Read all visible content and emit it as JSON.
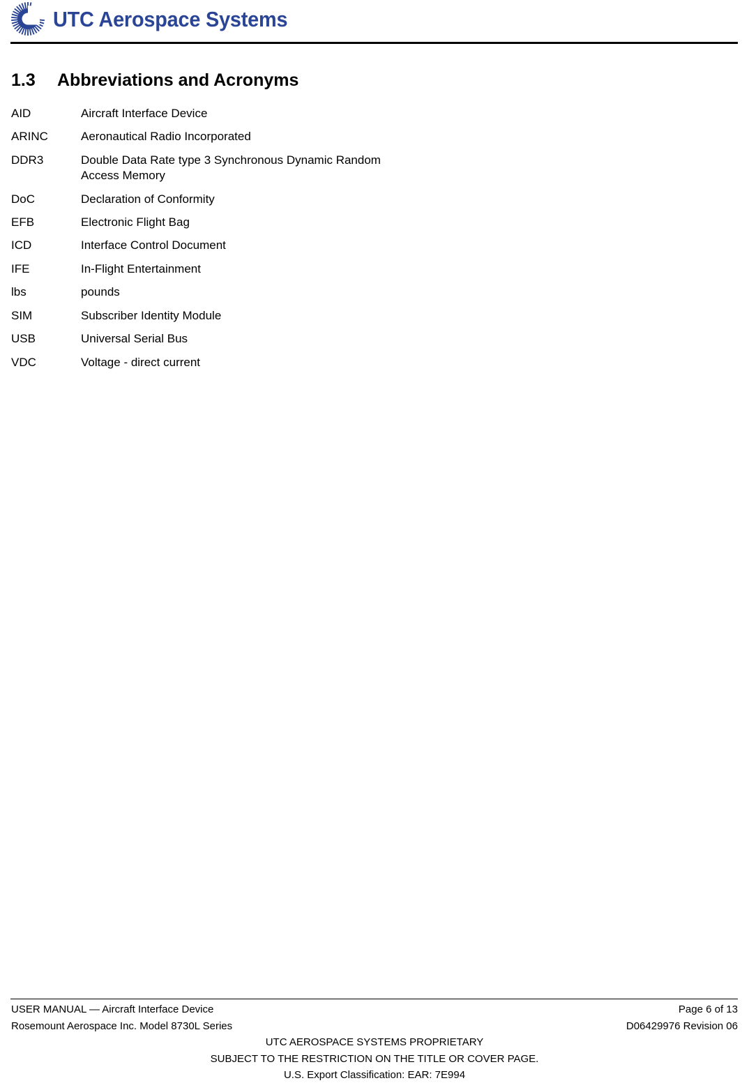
{
  "header": {
    "logo_icon": "utc-sunburst-icon",
    "logo_text": "UTC Aerospace Systems",
    "brand_color": "#2B4596"
  },
  "section": {
    "number": "1.3",
    "title": "Abbreviations and Acronyms"
  },
  "abbreviations": [
    {
      "term": "AID",
      "definition": "Aircraft Interface Device"
    },
    {
      "term": "ARINC",
      "definition": "Aeronautical Radio Incorporated"
    },
    {
      "term": "DDR3",
      "definition": "Double Data Rate type 3 Synchronous Dynamic Random Access Memory"
    },
    {
      "term": "DoC",
      "definition": "Declaration of Conformity"
    },
    {
      "term": "EFB",
      "definition": "Electronic Flight Bag"
    },
    {
      "term": "ICD",
      "definition": "Interface Control Document"
    },
    {
      "term": "IFE",
      "definition": "In-Flight Entertainment"
    },
    {
      "term": "lbs",
      "definition": "pounds"
    },
    {
      "term": "SIM",
      "definition": "Subscriber Identity Module"
    },
    {
      "term": "USB",
      "definition": "Universal Serial Bus"
    },
    {
      "term": "VDC",
      "definition": "Voltage - direct current"
    }
  ],
  "footer": {
    "doc_title": "USER MANUAL — Aircraft Interface Device",
    "page_label": "Page 6 of 13",
    "company_model": "Rosemount Aerospace Inc. Model 8730L Series",
    "doc_number": "D06429976 Revision 06",
    "proprietary_line1": "UTC AEROSPACE SYSTEMS PROPRIETARY",
    "proprietary_line2": "SUBJECT TO THE RESTRICTION ON THE TITLE OR COVER PAGE.",
    "proprietary_line3": "U.S. Export Classification: EAR: 7E994"
  }
}
